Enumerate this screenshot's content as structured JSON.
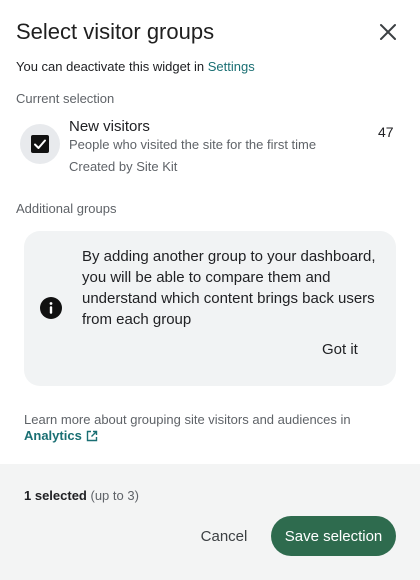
{
  "header": {
    "title": "Select visitor groups",
    "subtitle_text": "You can deactivate this widget in ",
    "settings_link": "Settings"
  },
  "current_selection": {
    "label": "Current selection",
    "item": {
      "title": "New visitors",
      "description": "People who visited the site for the first time",
      "created_by": "Created by Site Kit",
      "count": "47",
      "checked": true
    }
  },
  "additional_groups": {
    "label": "Additional groups",
    "notice_text": "By adding another group to your dashboard, you will be able to compare them and understand which content brings back users from each group",
    "got_it_label": "Got it"
  },
  "learn_more": {
    "text": "Learn more about grouping site visitors and audiences in",
    "link": "Analytics"
  },
  "footer": {
    "selected_count": "1 selected",
    "limit": "(up to 3)",
    "cancel_label": "Cancel",
    "save_label": "Save selection"
  },
  "colors": {
    "accent": "#2e6b4e",
    "link": "#1a6f73",
    "notice_bg": "#f1f3f4"
  }
}
